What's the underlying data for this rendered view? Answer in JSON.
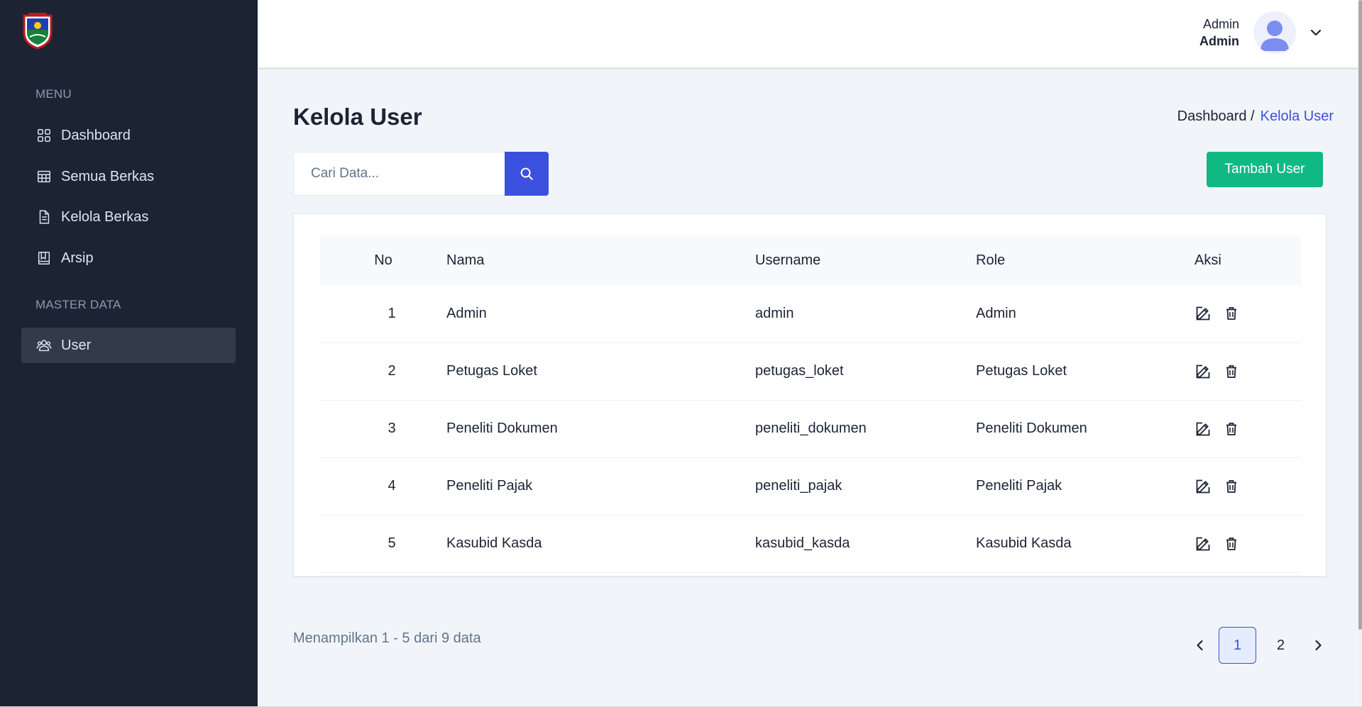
{
  "sidebar": {
    "menu_title": "MENU",
    "items": [
      {
        "label": "Dashboard",
        "icon": "grid-icon"
      },
      {
        "label": "Semua Berkas",
        "icon": "table-icon"
      },
      {
        "label": "Kelola Berkas",
        "icon": "file-icon"
      },
      {
        "label": "Arsip",
        "icon": "book-icon"
      }
    ],
    "master_title": "MASTER DATA",
    "master_items": [
      {
        "label": "User",
        "icon": "users-icon",
        "active": true
      }
    ]
  },
  "header": {
    "user_name": "Admin",
    "user_role": "Admin"
  },
  "page": {
    "title": "Kelola User",
    "breadcrumb_root": "Dashboard /",
    "breadcrumb_current": "Kelola User"
  },
  "search": {
    "placeholder": "Cari Data..."
  },
  "add_button_label": "Tambah User",
  "table": {
    "headers": [
      "No",
      "Nama",
      "Username",
      "Role",
      "Aksi"
    ],
    "rows": [
      {
        "no": "1",
        "nama": "Admin",
        "username": "admin",
        "role": "Admin"
      },
      {
        "no": "2",
        "nama": "Petugas Loket",
        "username": "petugas_loket",
        "role": "Petugas Loket"
      },
      {
        "no": "3",
        "nama": "Peneliti Dokumen",
        "username": "peneliti_dokumen",
        "role": "Peneliti Dokumen"
      },
      {
        "no": "4",
        "nama": "Peneliti Pajak",
        "username": "peneliti_pajak",
        "role": "Peneliti Pajak"
      },
      {
        "no": "5",
        "nama": "Kasubid Kasda",
        "username": "kasubid_kasda",
        "role": "Kasubid Kasda"
      }
    ]
  },
  "footer": {
    "info": "Menampilkan 1 - 5 dari 9 data",
    "pages": [
      "1",
      "2"
    ],
    "current_page": "1"
  },
  "colors": {
    "sidebar_bg": "#1c2434",
    "primary": "#3c50e0",
    "success": "#10b981"
  }
}
